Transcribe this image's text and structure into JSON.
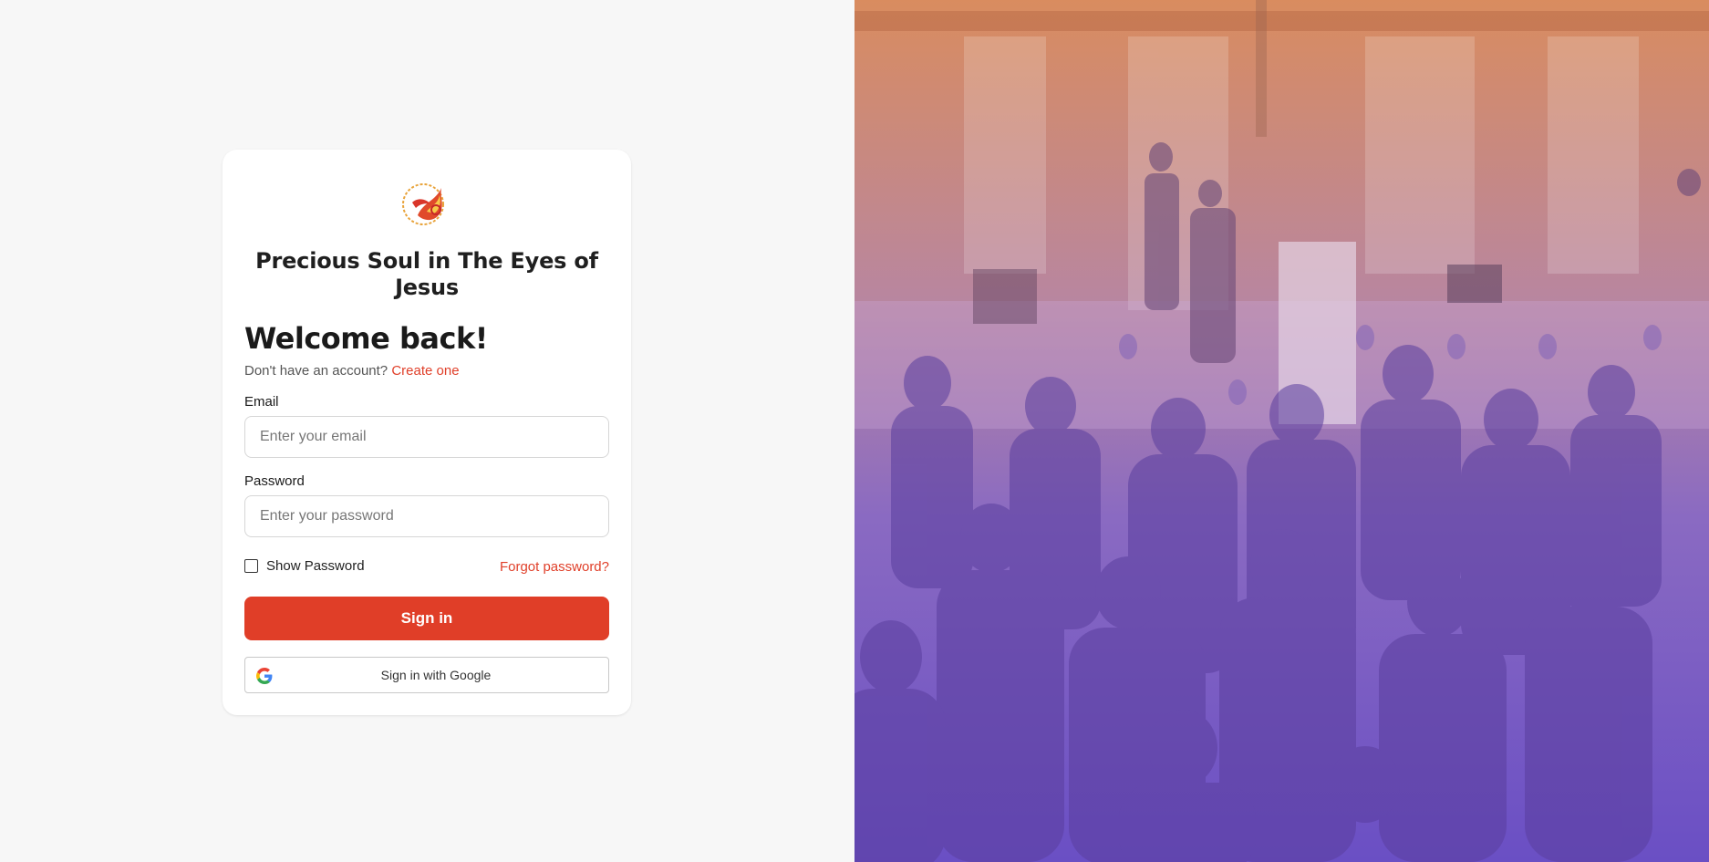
{
  "org": {
    "name": "Precious Soul in The Eyes of Jesus"
  },
  "login": {
    "heading": "Welcome back!",
    "no_account_text": "Don't have an account?",
    "create_link": "Create one",
    "email_label": "Email",
    "email_placeholder": "Enter your email",
    "email_value": "",
    "password_label": "Password",
    "password_placeholder": "Enter your password",
    "password_value": "",
    "show_password_label": "Show Password",
    "show_password_checked": false,
    "forgot_link": "Forgot password?",
    "signin_button": "Sign in",
    "google_button": "Sign in with Google"
  },
  "hero": {
    "image_subject": "worship-service-crowd-photo",
    "overlay_top_color": "#d98c5f",
    "overlay_bottom_color": "#6a4fc4"
  },
  "colors": {
    "accent": "#e03e28",
    "page_bg": "#f7f7f7",
    "card_bg": "#ffffff"
  },
  "icons": {
    "logo": "dove-flame-logo",
    "google": "google-g-icon"
  }
}
